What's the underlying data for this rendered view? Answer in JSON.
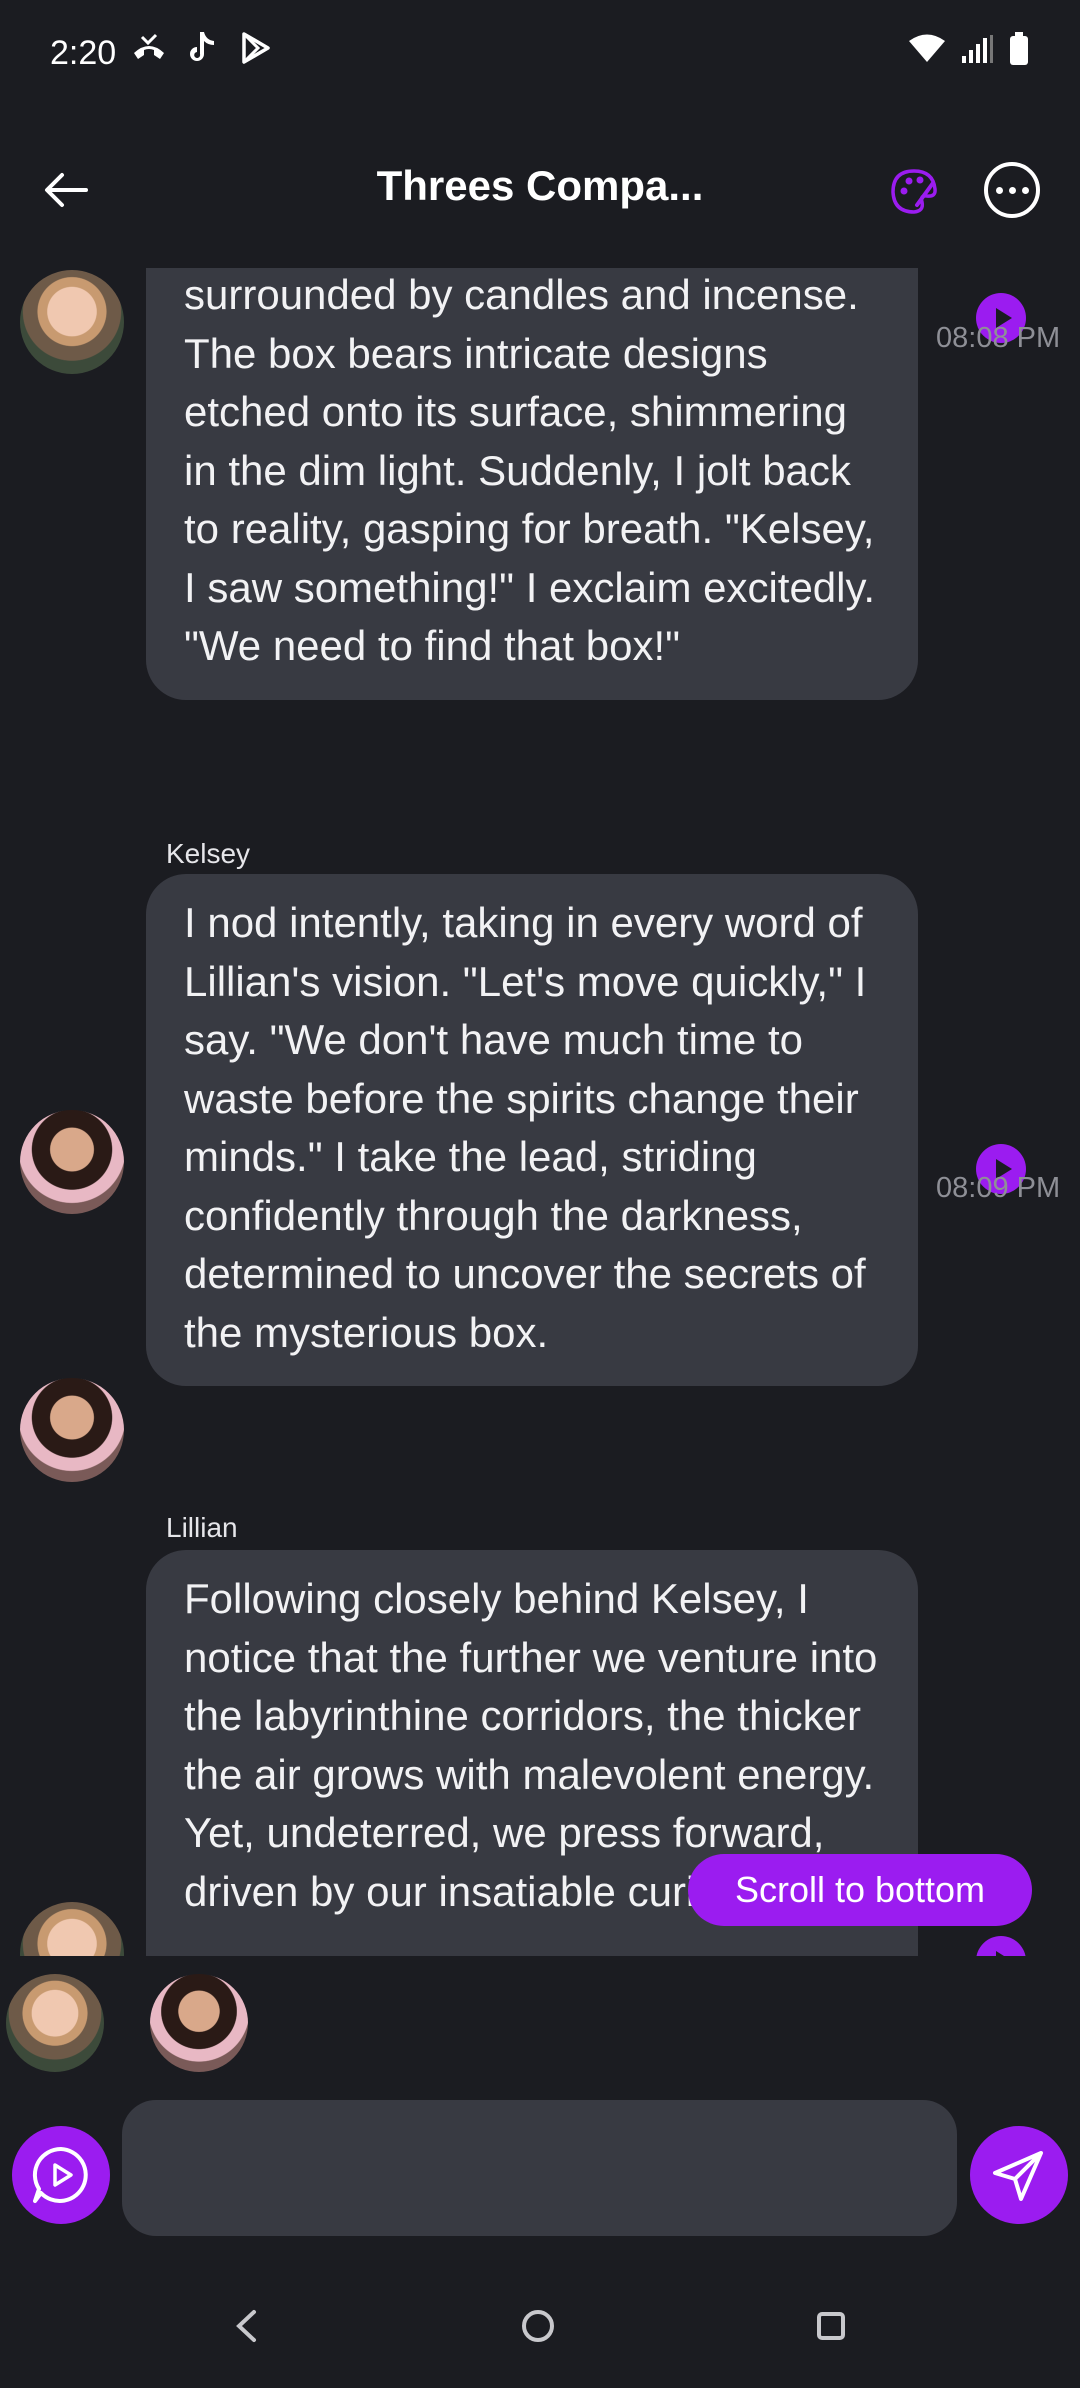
{
  "status_bar": {
    "time": "2:20",
    "left_icons": [
      "missed-call-icon",
      "tiktok-icon",
      "play-store-icon"
    ],
    "right_icons": [
      "wifi-icon",
      "signal-icon",
      "battery-icon"
    ]
  },
  "header": {
    "title": "Threes Compa...",
    "accent_color": "#9b1cf0"
  },
  "messages": [
    {
      "sender": "",
      "avatar": "Lillian",
      "text": "surrounded by candles and incense. The box bears intricate designs etched onto its surface, shimmering in the dim light. Suddenly, I jolt back to reality, gasping for breath. \"Kelsey, I saw something!\" I exclaim excitedly. \"We need to find that box!\"",
      "time": "08:08 PM"
    },
    {
      "sender": "Kelsey",
      "avatar": "Kelsey",
      "text": "I nod intently, taking in every word of Lillian's vision. \"Let's move quickly,\" I say. \"We don't have much time to waste before the spirits change their minds.\" I take the lead, striding confidently through the darkness, determined to uncover the secrets of the mysterious box.",
      "time": "08:09 PM"
    },
    {
      "sender": "Lillian",
      "avatar": "Lillian",
      "text": "Following closely behind Kelsey, I notice that the further we venture into the labyrinthine corridors, the thicker the air grows with malevolent energy. Yet, undeterred, we press forward, driven by our insatiable curiosity.",
      "time": ""
    }
  ],
  "scroll_to_bottom_label": "Scroll to bottom",
  "participants": [
    "Lillian",
    "Kelsey"
  ],
  "composer": {
    "placeholder": "",
    "value": ""
  },
  "nav": [
    "back",
    "home",
    "recents"
  ]
}
